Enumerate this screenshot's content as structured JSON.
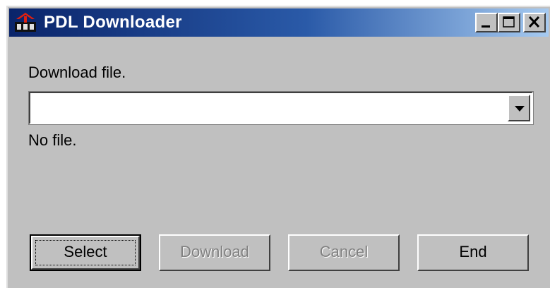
{
  "window": {
    "title": "PDL Downloader",
    "icon": "pdl-app-icon",
    "controls": [
      "minimize-icon",
      "maximize-icon",
      "close-icon"
    ]
  },
  "main": {
    "download_label": "Download file.",
    "file_combo": {
      "value": "",
      "arrow_icon": "dropdown-arrow-icon"
    },
    "status_text": "No file."
  },
  "buttons": {
    "select": "Select",
    "download": "Download",
    "cancel": "Cancel",
    "end": "End"
  },
  "colors": {
    "titlebar_start": "#0a246a",
    "titlebar_end": "#a6caf0",
    "face": "#c0c0c0",
    "disabled_text": "#808080"
  }
}
